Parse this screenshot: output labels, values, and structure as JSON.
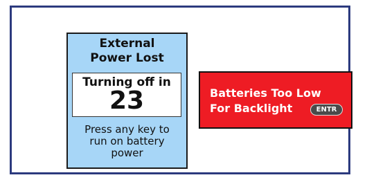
{
  "power_lost_dialog": {
    "title_line1": "External",
    "title_line2": "Power Lost",
    "countdown_label": "Turning off in",
    "countdown_value": "23",
    "message_line1": "Press any key to",
    "message_line2": "run on battery",
    "message_line3": "power",
    "background_color": "#a7d6f7"
  },
  "battery_low_alert": {
    "line1": "Batteries Too Low",
    "line2": "For Backlight",
    "entr_key_label": "ENTR",
    "background_color": "#ee1c24"
  },
  "frame_color": "#2c3a7e"
}
